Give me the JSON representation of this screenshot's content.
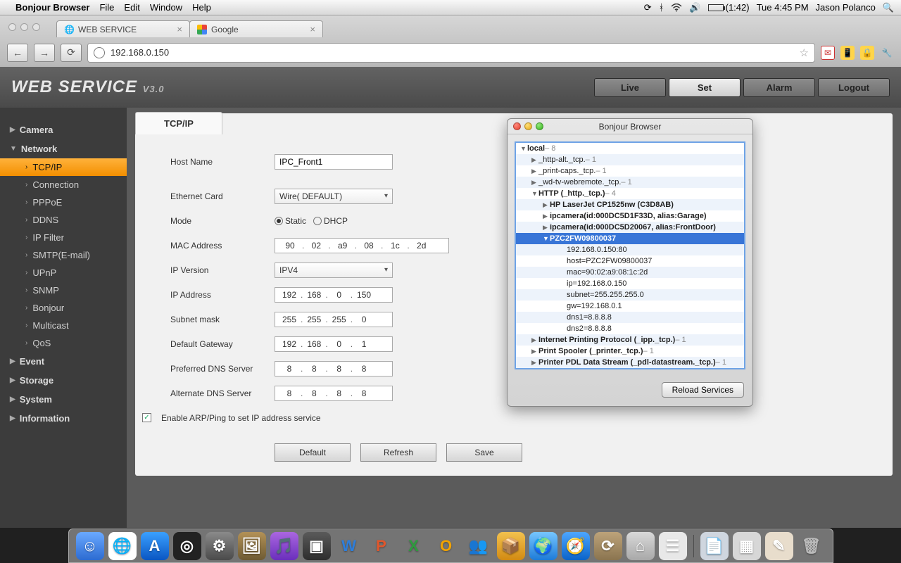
{
  "menubar": {
    "app_name": "Bonjour Browser",
    "items": [
      "File",
      "Edit",
      "Window",
      "Help"
    ],
    "battery": "(1:42)",
    "day_time": "Tue 4:45 PM",
    "user": "Jason Polanco"
  },
  "browser": {
    "tabs": [
      {
        "title": "WEB SERVICE"
      },
      {
        "title": "Google"
      }
    ],
    "url": "192.168.0.150",
    "ext_icons": [
      "✉",
      "📱",
      "🔒",
      "🔧"
    ]
  },
  "page": {
    "brand": "WEB  SERVICE",
    "brand_ver": "V3.0",
    "top_buttons": [
      "Live",
      "Set",
      "Alarm",
      "Logout"
    ],
    "active_top": "Set",
    "sidebar": {
      "categories": [
        {
          "label": "Camera",
          "expanded": false,
          "items": []
        },
        {
          "label": "Network",
          "expanded": true,
          "items": [
            "TCP/IP",
            "Connection",
            "PPPoE",
            "DDNS",
            "IP Filter",
            "SMTP(E-mail)",
            "UPnP",
            "SNMP",
            "Bonjour",
            "Multicast",
            "QoS"
          ],
          "active": "TCP/IP"
        },
        {
          "label": "Event",
          "expanded": false,
          "items": []
        },
        {
          "label": "Storage",
          "expanded": false,
          "items": []
        },
        {
          "label": "System",
          "expanded": false,
          "items": []
        },
        {
          "label": "Information",
          "expanded": false,
          "items": []
        }
      ]
    },
    "panel": {
      "tab_label": "TCP/IP",
      "host_name": {
        "label": "Host Name",
        "value": "IPC_Front1"
      },
      "ethernet": {
        "label": "Ethernet Card",
        "value": "Wire( DEFAULT)"
      },
      "mode": {
        "label": "Mode",
        "options": [
          "Static",
          "DHCP"
        ],
        "selected": "Static"
      },
      "mac": {
        "label": "MAC Address",
        "octets": [
          "90",
          "02",
          "a9",
          "08",
          "1c",
          "2d"
        ]
      },
      "ip_ver": {
        "label": "IP Version",
        "value": "IPV4"
      },
      "ip": {
        "label": "IP Address",
        "octets": [
          "192",
          "168",
          "0",
          "150"
        ]
      },
      "subnet": {
        "label": "Subnet mask",
        "octets": [
          "255",
          "255",
          "255",
          "0"
        ]
      },
      "gateway": {
        "label": "Default Gateway",
        "octets": [
          "192",
          "168",
          "0",
          "1"
        ]
      },
      "dns1": {
        "label": "Preferred DNS Server",
        "octets": [
          "8",
          "8",
          "8",
          "8"
        ]
      },
      "dns2": {
        "label": "Alternate DNS Server",
        "octets": [
          "8",
          "8",
          "8",
          "8"
        ]
      },
      "arp": {
        "label": "Enable ARP/Ping to set IP address service",
        "checked": true
      },
      "buttons": [
        "Default",
        "Refresh",
        "Save"
      ]
    }
  },
  "bonjour_window": {
    "title": "Bonjour Browser",
    "reload_label": "Reload Services",
    "rows": [
      {
        "depth": 1,
        "tri": "▼",
        "bold": true,
        "text": "local",
        "suffix": " – 8"
      },
      {
        "depth": 2,
        "tri": "▶",
        "bold": false,
        "text": "_http-alt._tcp.",
        "suffix": " – 1"
      },
      {
        "depth": 2,
        "tri": "▶",
        "bold": false,
        "text": "_print-caps._tcp.",
        "suffix": " – 1"
      },
      {
        "depth": 2,
        "tri": "▶",
        "bold": false,
        "text": "_wd-tv-webremote._tcp.",
        "suffix": " – 1"
      },
      {
        "depth": 2,
        "tri": "▼",
        "bold": true,
        "text": "HTTP (_http._tcp.)",
        "suffix": " – 4"
      },
      {
        "depth": 3,
        "tri": "▶",
        "bold": true,
        "text": "HP LaserJet CP1525nw (C3D8AB)",
        "suffix": ""
      },
      {
        "depth": 3,
        "tri": "▶",
        "bold": true,
        "text": "ipcamera(id:000DC5D1F33D, alias:Garage)",
        "suffix": ""
      },
      {
        "depth": 3,
        "tri": "▶",
        "bold": true,
        "text": "ipcamera(id:000DC5D20067, alias:FrontDoor)",
        "suffix": ""
      },
      {
        "depth": 3,
        "tri": "▼",
        "bold": true,
        "text": "PZC2FW09800037",
        "suffix": "",
        "selected": true
      },
      {
        "depth": 5,
        "tri": "",
        "bold": false,
        "text": "192.168.0.150:80",
        "suffix": ""
      },
      {
        "depth": 5,
        "tri": "",
        "bold": false,
        "text": "host=PZC2FW09800037",
        "suffix": ""
      },
      {
        "depth": 5,
        "tri": "",
        "bold": false,
        "text": "mac=90:02:a9:08:1c:2d",
        "suffix": ""
      },
      {
        "depth": 5,
        "tri": "",
        "bold": false,
        "text": "ip=192.168.0.150",
        "suffix": ""
      },
      {
        "depth": 5,
        "tri": "",
        "bold": false,
        "text": "subnet=255.255.255.0",
        "suffix": ""
      },
      {
        "depth": 5,
        "tri": "",
        "bold": false,
        "text": "gw=192.168.0.1",
        "suffix": ""
      },
      {
        "depth": 5,
        "tri": "",
        "bold": false,
        "text": "dns1=8.8.8.8",
        "suffix": ""
      },
      {
        "depth": 5,
        "tri": "",
        "bold": false,
        "text": "dns2=8.8.8.8",
        "suffix": ""
      },
      {
        "depth": 2,
        "tri": "▶",
        "bold": true,
        "text": "Internet Printing Protocol (_ipp._tcp.)",
        "suffix": " – 1"
      },
      {
        "depth": 2,
        "tri": "▶",
        "bold": true,
        "text": "Print Spooler (_printer._tcp.)",
        "suffix": " – 1"
      },
      {
        "depth": 2,
        "tri": "▶",
        "bold": true,
        "text": "Printer PDL Data Stream (_pdl-datastream._tcp.)",
        "suffix": " – 1"
      }
    ]
  },
  "dock": {
    "main": [
      {
        "bg": "linear-gradient(#6aa9ff,#2c6bd1)",
        "glyph": "☺"
      },
      {
        "bg": "#fff",
        "glyph": "🌐"
      },
      {
        "bg": "linear-gradient(#3aa0ff,#0a56c2)",
        "glyph": "A"
      },
      {
        "bg": "#222",
        "glyph": "◎"
      },
      {
        "bg": "linear-gradient(#8a8a8a,#4a4a4a)",
        "glyph": "⚙"
      },
      {
        "bg": "linear-gradient(#b39156,#6d5a33)",
        "glyph": "🖼"
      },
      {
        "bg": "linear-gradient(#aa66e0,#6a2fbc)",
        "glyph": "🎵"
      },
      {
        "bg": "linear-gradient(#5a5a5a,#2d2d2d)",
        "glyph": "▣"
      },
      {
        "bg": "transparent",
        "glyph": "W",
        "color": "#2d7edb"
      },
      {
        "bg": "transparent",
        "glyph": "P",
        "color": "#e0562b"
      },
      {
        "bg": "transparent",
        "glyph": "X",
        "color": "#2e9a3e"
      },
      {
        "bg": "transparent",
        "glyph": "O",
        "color": "#f2a300"
      },
      {
        "bg": "transparent",
        "glyph": "👥",
        "color": "#6cc24a"
      },
      {
        "bg": "linear-gradient(#f2c14e,#d28a12)",
        "glyph": "📦"
      },
      {
        "bg": "linear-gradient(#76c6ff,#1d7bd8)",
        "glyph": "🌍"
      },
      {
        "bg": "linear-gradient(#4da6ff,#0a63c9)",
        "glyph": "🧭"
      },
      {
        "bg": "linear-gradient(#bda37a,#8a744f)",
        "glyph": "⟳"
      },
      {
        "bg": "linear-gradient(#d9d9d9,#a8a8a8)",
        "glyph": "⌂"
      },
      {
        "bg": "#e8e8e8",
        "glyph": "☰"
      }
    ],
    "right": [
      {
        "bg": "#cfd6df",
        "glyph": "📄"
      },
      {
        "bg": "#d7d7d7",
        "glyph": "▦"
      },
      {
        "bg": "#e8ddcc",
        "glyph": "✎"
      },
      {
        "bg": "transparent",
        "glyph": "🗑",
        "color": "#bbb"
      }
    ]
  }
}
